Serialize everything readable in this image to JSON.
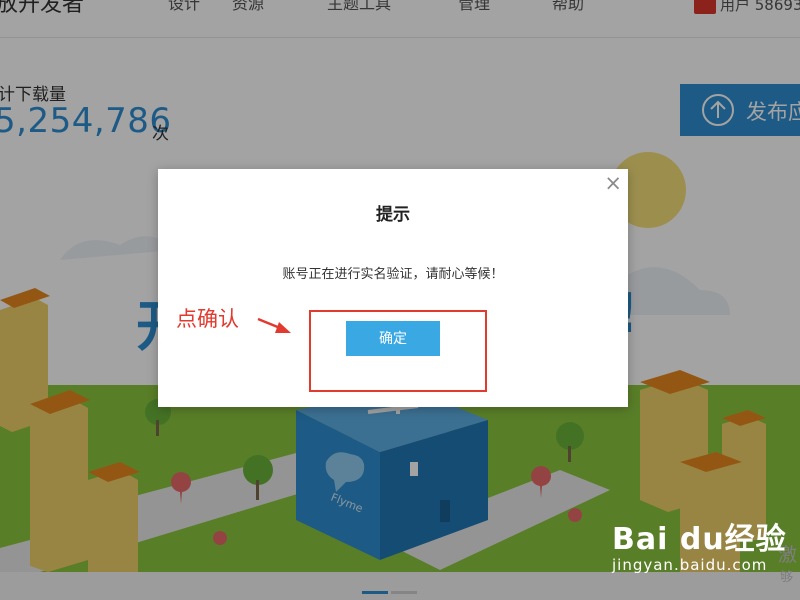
{
  "nav": {
    "brand": "放开发者",
    "items": [
      "设计",
      "资源",
      "主题工具",
      "管理",
      "帮助"
    ],
    "user_text": "用户 58693"
  },
  "stats": {
    "label": "计下载量",
    "value": "5,254,786",
    "unit": "次"
  },
  "publish_button": {
    "label": "发布应"
  },
  "banner": {
    "text_left": "开",
    "text_right": "!"
  },
  "illustration": {
    "cube_label": "Flyme",
    "side_text_1": "激",
    "side_text_2": "够"
  },
  "dialog": {
    "title": "提示",
    "message": "账号正在进行实名验证，请耐心等候！",
    "confirm_label": "确定",
    "close_symbol": "×"
  },
  "annotation": {
    "text": "点确认",
    "color": "#e23a2e"
  },
  "watermark": {
    "logo": "Bai du经验",
    "url": "jingyan.baidu.com"
  },
  "colors": {
    "accent": "#2e8ed0",
    "button": "#3aa8e3",
    "grass": "#8cc63f"
  }
}
